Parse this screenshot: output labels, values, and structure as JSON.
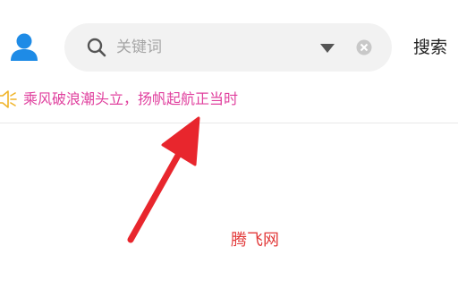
{
  "search": {
    "placeholder": "关键词",
    "value": "",
    "button_label": "搜索"
  },
  "notice": {
    "text": "乘风破浪潮头立，扬帆起航正当时"
  },
  "watermark": "腾飞网",
  "icons": {
    "avatar": "user-icon",
    "search": "search-icon",
    "dropdown": "triangle-down-icon",
    "clear": "close-circle-icon",
    "notice": "speaker-icon",
    "annotation": "arrow-annotation"
  },
  "colors": {
    "accent_blue": "#1e8be6",
    "notice_pink": "#e0409e",
    "speaker_yellow": "#f0b429",
    "arrow_red": "#e8262d",
    "search_bg": "#f2f2f2"
  }
}
